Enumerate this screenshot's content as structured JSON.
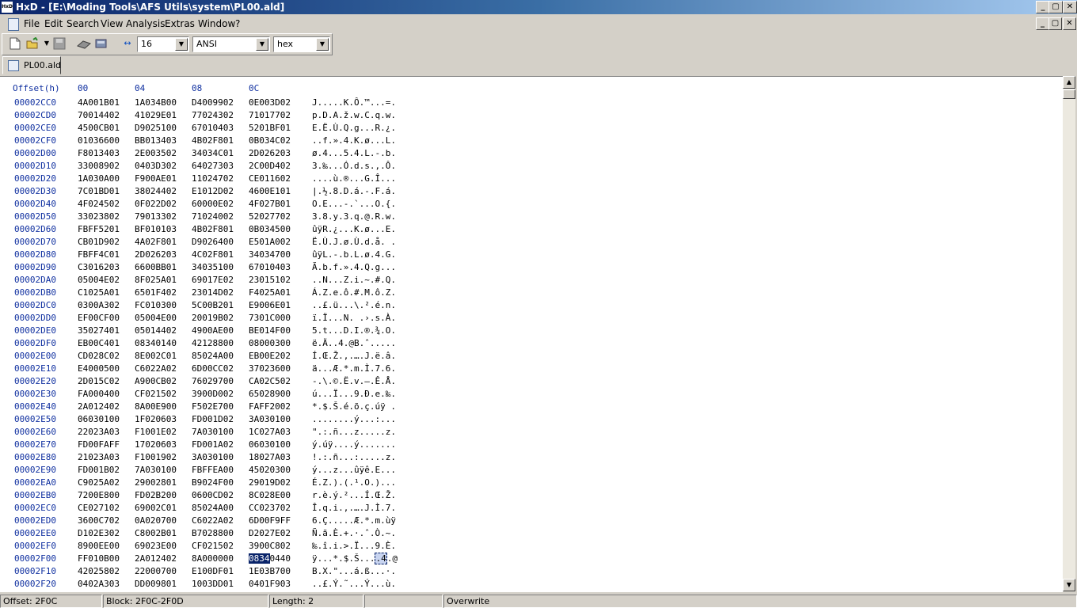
{
  "window": {
    "title": "HxD - [E:\\Moding Tools\\AFS Utils\\system\\PL00.ald]",
    "app_icon": "HxD",
    "controls": {
      "minimize": "_",
      "maximize": "▢",
      "close": "✕"
    }
  },
  "menu": {
    "items": [
      "File",
      "Edit",
      "Search",
      "View",
      "Analysis",
      "Extras",
      "Window",
      "?"
    ]
  },
  "toolbar": {
    "icons": [
      "new-file-icon",
      "open-file-icon",
      "save-icon",
      "open-disk-icon",
      "open-ram-icon",
      "bytes-per-row-icon"
    ],
    "bytes_per_row": "16",
    "charset": "ANSI",
    "offset_base": "hex"
  },
  "tab": {
    "label": "PL00.ald"
  },
  "hex_view": {
    "header": {
      "offset": "Offset(h)",
      "columns": [
        "00",
        "04",
        "08",
        "0C"
      ]
    },
    "rows": [
      {
        "offset": "00002CC0",
        "hex": [
          "4A001B01",
          "1A034B00",
          "D4009902",
          "0E003D02"
        ],
        "text": "J.....K.Ô.™...=."
      },
      {
        "offset": "00002CD0",
        "hex": [
          "70014402",
          "41029E01",
          "77024302",
          "71017702"
        ],
        "text": "p.D.A.ž.w.C.q.w."
      },
      {
        "offset": "00002CE0",
        "hex": [
          "4500CB01",
          "D9025100",
          "67010403",
          "5201BF01"
        ],
        "text": "E.Ë.Ù.Q.g...R.¿."
      },
      {
        "offset": "00002CF0",
        "hex": [
          "01036600",
          "BB013403",
          "4B02F801",
          "0B034C02"
        ],
        "text": "..f.».4.K.ø...L."
      },
      {
        "offset": "00002D00",
        "hex": [
          "F8013403",
          "2E003502",
          "34034C01",
          "2D026203"
        ],
        "text": "ø.4...5.4.L.-.b."
      },
      {
        "offset": "00002D10",
        "hex": [
          "33008902",
          "0403D302",
          "64027303",
          "2C00D402"
        ],
        "text": "3.‰...Ó.d.s.,.Ô."
      },
      {
        "offset": "00002D20",
        "hex": [
          "1A030A00",
          "F900AE01",
          "11024702",
          "CE011602"
        ],
        "text": "....ù.®...G.Î..."
      },
      {
        "offset": "00002D30",
        "hex": [
          "7C01BD01",
          "38024402",
          "E1012D02",
          "4600E101"
        ],
        "text": "|.½.8.D.á.-.F.á."
      },
      {
        "offset": "00002D40",
        "hex": [
          "4F024502",
          "0F022D02",
          "60000E02",
          "4F027B01"
        ],
        "text": "O.E...-.`...O.{."
      },
      {
        "offset": "00002D50",
        "hex": [
          "33023802",
          "79013302",
          "71024002",
          "52027702"
        ],
        "text": "3.8.y.3.q.@.R.w."
      },
      {
        "offset": "00002D60",
        "hex": [
          "FBFF5201",
          "BF010103",
          "4B02F801",
          "0B034500"
        ],
        "text": "ûÿR.¿...K.ø...E."
      },
      {
        "offset": "00002D70",
        "hex": [
          "CB01D902",
          "4A02F801",
          "D9026400",
          "E501A002"
        ],
        "text": "Ë.Ù.J.ø.Ù.d.å. ."
      },
      {
        "offset": "00002D80",
        "hex": [
          "FBFF4C01",
          "2D026203",
          "4C02F801",
          "34034700"
        ],
        "text": "ûÿL.-.b.L.ø.4.G."
      },
      {
        "offset": "00002D90",
        "hex": [
          "C3016203",
          "6600BB01",
          "34035100",
          "67010403"
        ],
        "text": "Ã.b.f.».4.Q.g..."
      },
      {
        "offset": "00002DA0",
        "hex": [
          "05004E02",
          "8F025A01",
          "69017E02",
          "23015102"
        ],
        "text": "..N...Z.i.~.#.Q."
      },
      {
        "offset": "00002DB0",
        "hex": [
          "C1025A01",
          "6501F402",
          "23014D02",
          "F4025A01"
        ],
        "text": "Á.Z.e.ô.#.M.ô.Z."
      },
      {
        "offset": "00002DC0",
        "hex": [
          "0300A302",
          "FC010300",
          "5C00B201",
          "E9006E01"
        ],
        "text": "..£.ü...\\.².é.n."
      },
      {
        "offset": "00002DD0",
        "hex": [
          "EF00CF00",
          "05004E00",
          "20019B02",
          "7301C000"
        ],
        "text": "ï.Ï...N. .›.s.À."
      },
      {
        "offset": "00002DE0",
        "hex": [
          "35027401",
          "05014402",
          "4900AE00",
          "BE014F00"
        ],
        "text": "5.t...D.I.®.¾.O."
      },
      {
        "offset": "00002DF0",
        "hex": [
          "EB00C401",
          "08340140",
          "42128800",
          "08000300"
        ],
        "text": "ë.Ä..4.@B.ˆ....."
      },
      {
        "offset": "00002E00",
        "hex": [
          "CD028C02",
          "8E002C01",
          "85024A00",
          "EB00E202"
        ],
        "text": "Í.Œ.Ž.,.….J.ë.â."
      },
      {
        "offset": "00002E10",
        "hex": [
          "E4000500",
          "C6022A02",
          "6D00CC02",
          "37023600"
        ],
        "text": "ä...Æ.*.m.Ì.7.6."
      },
      {
        "offset": "00002E20",
        "hex": [
          "2D015C02",
          "A900CB02",
          "76029700",
          "CA02C502"
        ],
        "text": "-.\\.©.Ë.v.—.Ê.Å."
      },
      {
        "offset": "00002E30",
        "hex": [
          "FA000400",
          "CF021502",
          "3900D002",
          "65028900"
        ],
        "text": "ú...Ï...9.Ð.e.‰."
      },
      {
        "offset": "00002E40",
        "hex": [
          "2A012402",
          "8A00E900",
          "F502E700",
          "FAFF2002"
        ],
        "text": "*.$.Š.é.õ.ç.úÿ ."
      },
      {
        "offset": "00002E50",
        "hex": [
          "06030100",
          "1F020603",
          "FD001D02",
          "3A030100"
        ],
        "text": "........ý...:..."
      },
      {
        "offset": "00002E60",
        "hex": [
          "22023A03",
          "F1001E02",
          "7A030100",
          "1C027A03"
        ],
        "text": "\".:.ñ...z.....z."
      },
      {
        "offset": "00002E70",
        "hex": [
          "FD00FAFF",
          "17020603",
          "FD001A02",
          "06030100"
        ],
        "text": "ý.úÿ....ý......."
      },
      {
        "offset": "00002E80",
        "hex": [
          "21023A03",
          "F1001902",
          "3A030100",
          "18027A03"
        ],
        "text": "!.:.ñ...:.....z."
      },
      {
        "offset": "00002E90",
        "hex": [
          "FD001B02",
          "7A030100",
          "FBFFEA00",
          "45020300"
        ],
        "text": "ý...z...ûÿê.E..."
      },
      {
        "offset": "00002EA0",
        "hex": [
          "C9025A02",
          "29002801",
          "B9024F00",
          "29019D02"
        ],
        "text": "É.Z.).(.¹.O.)..."
      },
      {
        "offset": "00002EB0",
        "hex": [
          "7200E800",
          "FD02B200",
          "0600CD02",
          "8C028E00"
        ],
        "text": "r.è.ý.²...Í.Œ.Ž."
      },
      {
        "offset": "00002EC0",
        "hex": [
          "CE027102",
          "69002C01",
          "85024A00",
          "CC023702"
        ],
        "text": "Î.q.i.,.….J.Ì.7."
      },
      {
        "offset": "00002ED0",
        "hex": [
          "3600C702",
          "0A020700",
          "C6022A02",
          "6D00F9FF"
        ],
        "text": "6.Ç.....Æ.*.m.ùÿ"
      },
      {
        "offset": "00002EE0",
        "hex": [
          "D102E302",
          "C8002B01",
          "B7028800",
          "D2027E02"
        ],
        "text": "Ñ.ã.È.+.·.ˆ.Ò.~."
      },
      {
        "offset": "00002EF0",
        "hex": [
          "8900EE00",
          "69023E00",
          "CF021502",
          "3900C802"
        ],
        "text": "‰.î.i.>.Ï...9.È."
      },
      {
        "offset": "00002F00",
        "hex": [
          "FF010B00",
          "2A012402",
          "8A000000",
          "08340440"
        ],
        "text": "ÿ...*.$.Š....4.@",
        "sel_hex": "0834",
        "sel_text": ".4"
      },
      {
        "offset": "00002F10",
        "hex": [
          "42025802",
          "22000700",
          "E100DF01",
          "1E03B700"
        ],
        "text": "B.X.\"...á.ß...·."
      },
      {
        "offset": "00002F20",
        "hex": [
          "0402A303",
          "DD009801",
          "1003DD01",
          "0401F903"
        ],
        "text": "..£.Ý.˜...Ý...ù."
      }
    ]
  },
  "status": {
    "offset": "Offset: 2F0C",
    "block": "Block: 2F0C-2F0D",
    "length": "Length: 2",
    "empty": "",
    "mode": "Overwrite"
  },
  "colors": {
    "offset_text": "#1030a0",
    "selection": "#0a246a",
    "title_gradient_start": "#0a246a"
  }
}
